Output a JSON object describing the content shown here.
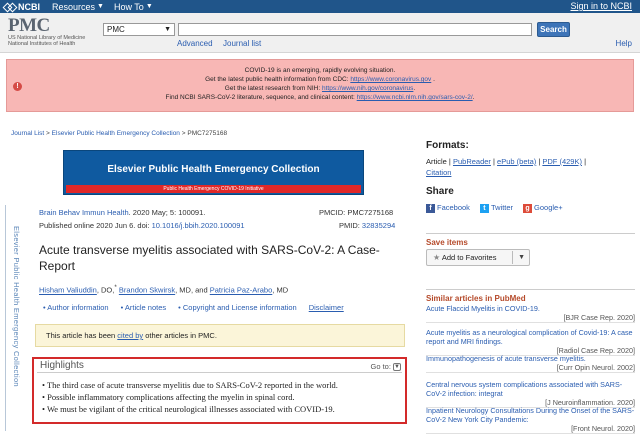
{
  "topbar": {
    "brand": "NCBI",
    "resources": "Resources",
    "howto": "How To",
    "signin": "Sign in to NCBI"
  },
  "header": {
    "logo": "PMC",
    "logo_sub1": "US National Library of Medicine",
    "logo_sub2": "National Institutes of Health",
    "db": "PMC",
    "search_value": "",
    "search_button": "Search",
    "advanced": "Advanced",
    "journal_list": "Journal list",
    "help": "Help"
  },
  "alert": {
    "icon": "!",
    "l1": "COVID-19 is an emerging, rapidly evolving situation.",
    "l2a": "Get the latest public health information from CDC: ",
    "l2b": "https://www.coronavirus.gov",
    "l2c": " .",
    "l3a": "Get the latest research from NIH: ",
    "l3b": "https://www.nih.gov/coronavirus",
    "l3c": ".",
    "l4a": "Find NCBI SARS-CoV-2 literature, sequence, and clinical content: ",
    "l4b": "https://www.ncbi.nlm.nih.gov/sars-cov-2/",
    "l4c": "."
  },
  "breadcrumb": {
    "a": "Journal List",
    "sep1": " > ",
    "b": "Elsevier Public Health Emergency Collection",
    "sep2": " > ",
    "c": "PMC7275168"
  },
  "banner": {
    "title": "Elsevier Public Health Emergency Collection",
    "sub": "Public Health Emergency COVID-19 Initiative"
  },
  "side_vertical": "Elsevier Public Health Emergency Collection",
  "article": {
    "journal": "Brain Behav Immun Health",
    "cit1_rest": ". 2020 May; 5: 100091.",
    "cit2_pre": "Published online 2020 Jun 6. doi: ",
    "doi": "10.1016/j.bbih.2020.100091",
    "pmcid": "PMCID: PMC7275168",
    "pmid_label": "PMID: ",
    "pmid": "32835294",
    "title": "Acute transverse myelitis associated with SARS-CoV-2: A Case-Report",
    "a1": "Hisham Valiuddin",
    "a1s": ", DO,",
    "a1m": "*",
    "a1t": " ",
    "a2": "Brandon Skwirsk",
    "a2s": ", MD, and ",
    "a3": "Patricia Paz-Arabo",
    "a3s": ", MD",
    "meta1": "Author information",
    "meta2": "Article notes",
    "meta3": "Copyright and License information",
    "meta4": "Disclaimer",
    "cited_pre": "This article has been ",
    "cited_link": "cited by",
    "cited_post": " other articles in PMC."
  },
  "highlights": {
    "title": "Highlights",
    "goto": "Go to: ",
    "items": [
      "• The third case of acute transverse myelitis due to SARS-CoV-2 reported in the world.",
      "• Possible inflammatory complications affecting the myelin in spinal cord.",
      "• We must be vigilant of the critical neurological illnesses associated with COVID-19."
    ]
  },
  "formats": {
    "title": "Formats:",
    "article": "Article",
    "pubreader": "PubReader",
    "epub": "ePub (beta)",
    "pdf": "PDF (429K)",
    "citation": "Citation",
    "sep": " | "
  },
  "share": {
    "title": "Share",
    "facebook": "Facebook",
    "twitter": "Twitter",
    "google": "Google+"
  },
  "saved": {
    "title": "Save items",
    "button": "Add to Favorites"
  },
  "similar": {
    "title": "Similar articles in PubMed",
    "items": [
      {
        "t": "Acute Flaccid Myelitis in COVID-19.",
        "s": "[BJR Case Rep. 2020]"
      },
      {
        "t": "Acute myelitis as a neurological complication of Covid-19: A case report and MRI findings.",
        "s": "[Radiol Case Rep. 2020]"
      },
      {
        "t": "Immunopathogenesis of acute transverse myelitis.",
        "s": "[Curr Opin Neurol. 2002]"
      },
      {
        "t": "Central nervous system complications associated with SARS-CoV-2 infection: integrat",
        "s": "[J Neuroinflammation. 2020]"
      },
      {
        "t": "Inpatient Neurology Consultations During the Onset of the SARS-CoV-2 New York City Pandemic:",
        "s": "[Front Neurol. 2020]"
      }
    ]
  }
}
